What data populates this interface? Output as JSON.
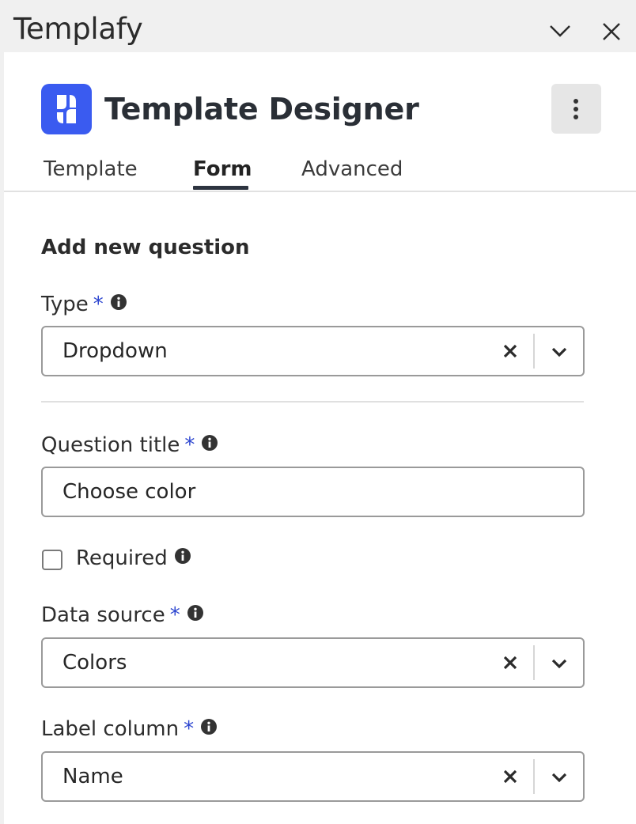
{
  "window": {
    "title": "Templafy",
    "minimize_icon": "chevron-down-icon",
    "close_icon": "close-icon"
  },
  "header": {
    "logo_icon": "templafy-logo-icon",
    "title": "Template Designer",
    "more_icon": "more-vertical-icon"
  },
  "tabs": [
    {
      "label": "Template",
      "active": false
    },
    {
      "label": "Form",
      "active": true
    },
    {
      "label": "Advanced",
      "active": false
    }
  ],
  "form": {
    "section_title": "Add new question",
    "type": {
      "label": "Type",
      "required_mark": "*",
      "value": "Dropdown"
    },
    "question_title": {
      "label": "Question title",
      "required_mark": "*",
      "value": "Choose color"
    },
    "required_checkbox": {
      "label": "Required",
      "checked": false
    },
    "data_source": {
      "label": "Data source",
      "required_mark": "*",
      "value": "Colors"
    },
    "label_column": {
      "label": "Label column",
      "required_mark": "*",
      "value": "Name"
    }
  },
  "colors": {
    "accent": "#3a5bf0",
    "required_mark": "#2e47d0",
    "tab_underline": "#2d3440"
  }
}
